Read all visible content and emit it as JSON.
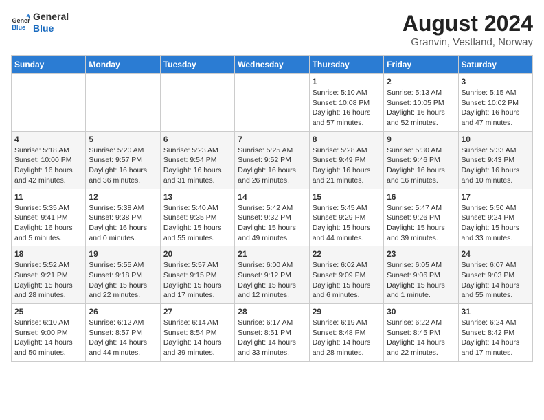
{
  "header": {
    "logo_line1": "General",
    "logo_line2": "Blue",
    "title": "August 2024",
    "subtitle": "Granvin, Vestland, Norway"
  },
  "calendar": {
    "days_of_week": [
      "Sunday",
      "Monday",
      "Tuesday",
      "Wednesday",
      "Thursday",
      "Friday",
      "Saturday"
    ],
    "weeks": [
      [
        {
          "day": "",
          "content": ""
        },
        {
          "day": "",
          "content": ""
        },
        {
          "day": "",
          "content": ""
        },
        {
          "day": "",
          "content": ""
        },
        {
          "day": "1",
          "content": "Sunrise: 5:10 AM\nSunset: 10:08 PM\nDaylight: 16 hours and 57 minutes."
        },
        {
          "day": "2",
          "content": "Sunrise: 5:13 AM\nSunset: 10:05 PM\nDaylight: 16 hours and 52 minutes."
        },
        {
          "day": "3",
          "content": "Sunrise: 5:15 AM\nSunset: 10:02 PM\nDaylight: 16 hours and 47 minutes."
        }
      ],
      [
        {
          "day": "4",
          "content": "Sunrise: 5:18 AM\nSunset: 10:00 PM\nDaylight: 16 hours and 42 minutes."
        },
        {
          "day": "5",
          "content": "Sunrise: 5:20 AM\nSunset: 9:57 PM\nDaylight: 16 hours and 36 minutes."
        },
        {
          "day": "6",
          "content": "Sunrise: 5:23 AM\nSunset: 9:54 PM\nDaylight: 16 hours and 31 minutes."
        },
        {
          "day": "7",
          "content": "Sunrise: 5:25 AM\nSunset: 9:52 PM\nDaylight: 16 hours and 26 minutes."
        },
        {
          "day": "8",
          "content": "Sunrise: 5:28 AM\nSunset: 9:49 PM\nDaylight: 16 hours and 21 minutes."
        },
        {
          "day": "9",
          "content": "Sunrise: 5:30 AM\nSunset: 9:46 PM\nDaylight: 16 hours and 16 minutes."
        },
        {
          "day": "10",
          "content": "Sunrise: 5:33 AM\nSunset: 9:43 PM\nDaylight: 16 hours and 10 minutes."
        }
      ],
      [
        {
          "day": "11",
          "content": "Sunrise: 5:35 AM\nSunset: 9:41 PM\nDaylight: 16 hours and 5 minutes."
        },
        {
          "day": "12",
          "content": "Sunrise: 5:38 AM\nSunset: 9:38 PM\nDaylight: 16 hours and 0 minutes."
        },
        {
          "day": "13",
          "content": "Sunrise: 5:40 AM\nSunset: 9:35 PM\nDaylight: 15 hours and 55 minutes."
        },
        {
          "day": "14",
          "content": "Sunrise: 5:42 AM\nSunset: 9:32 PM\nDaylight: 15 hours and 49 minutes."
        },
        {
          "day": "15",
          "content": "Sunrise: 5:45 AM\nSunset: 9:29 PM\nDaylight: 15 hours and 44 minutes."
        },
        {
          "day": "16",
          "content": "Sunrise: 5:47 AM\nSunset: 9:26 PM\nDaylight: 15 hours and 39 minutes."
        },
        {
          "day": "17",
          "content": "Sunrise: 5:50 AM\nSunset: 9:24 PM\nDaylight: 15 hours and 33 minutes."
        }
      ],
      [
        {
          "day": "18",
          "content": "Sunrise: 5:52 AM\nSunset: 9:21 PM\nDaylight: 15 hours and 28 minutes."
        },
        {
          "day": "19",
          "content": "Sunrise: 5:55 AM\nSunset: 9:18 PM\nDaylight: 15 hours and 22 minutes."
        },
        {
          "day": "20",
          "content": "Sunrise: 5:57 AM\nSunset: 9:15 PM\nDaylight: 15 hours and 17 minutes."
        },
        {
          "day": "21",
          "content": "Sunrise: 6:00 AM\nSunset: 9:12 PM\nDaylight: 15 hours and 12 minutes."
        },
        {
          "day": "22",
          "content": "Sunrise: 6:02 AM\nSunset: 9:09 PM\nDaylight: 15 hours and 6 minutes."
        },
        {
          "day": "23",
          "content": "Sunrise: 6:05 AM\nSunset: 9:06 PM\nDaylight: 15 hours and 1 minute."
        },
        {
          "day": "24",
          "content": "Sunrise: 6:07 AM\nSunset: 9:03 PM\nDaylight: 14 hours and 55 minutes."
        }
      ],
      [
        {
          "day": "25",
          "content": "Sunrise: 6:10 AM\nSunset: 9:00 PM\nDaylight: 14 hours and 50 minutes."
        },
        {
          "day": "26",
          "content": "Sunrise: 6:12 AM\nSunset: 8:57 PM\nDaylight: 14 hours and 44 minutes."
        },
        {
          "day": "27",
          "content": "Sunrise: 6:14 AM\nSunset: 8:54 PM\nDaylight: 14 hours and 39 minutes."
        },
        {
          "day": "28",
          "content": "Sunrise: 6:17 AM\nSunset: 8:51 PM\nDaylight: 14 hours and 33 minutes."
        },
        {
          "day": "29",
          "content": "Sunrise: 6:19 AM\nSunset: 8:48 PM\nDaylight: 14 hours and 28 minutes."
        },
        {
          "day": "30",
          "content": "Sunrise: 6:22 AM\nSunset: 8:45 PM\nDaylight: 14 hours and 22 minutes."
        },
        {
          "day": "31",
          "content": "Sunrise: 6:24 AM\nSunset: 8:42 PM\nDaylight: 14 hours and 17 minutes."
        }
      ]
    ]
  }
}
